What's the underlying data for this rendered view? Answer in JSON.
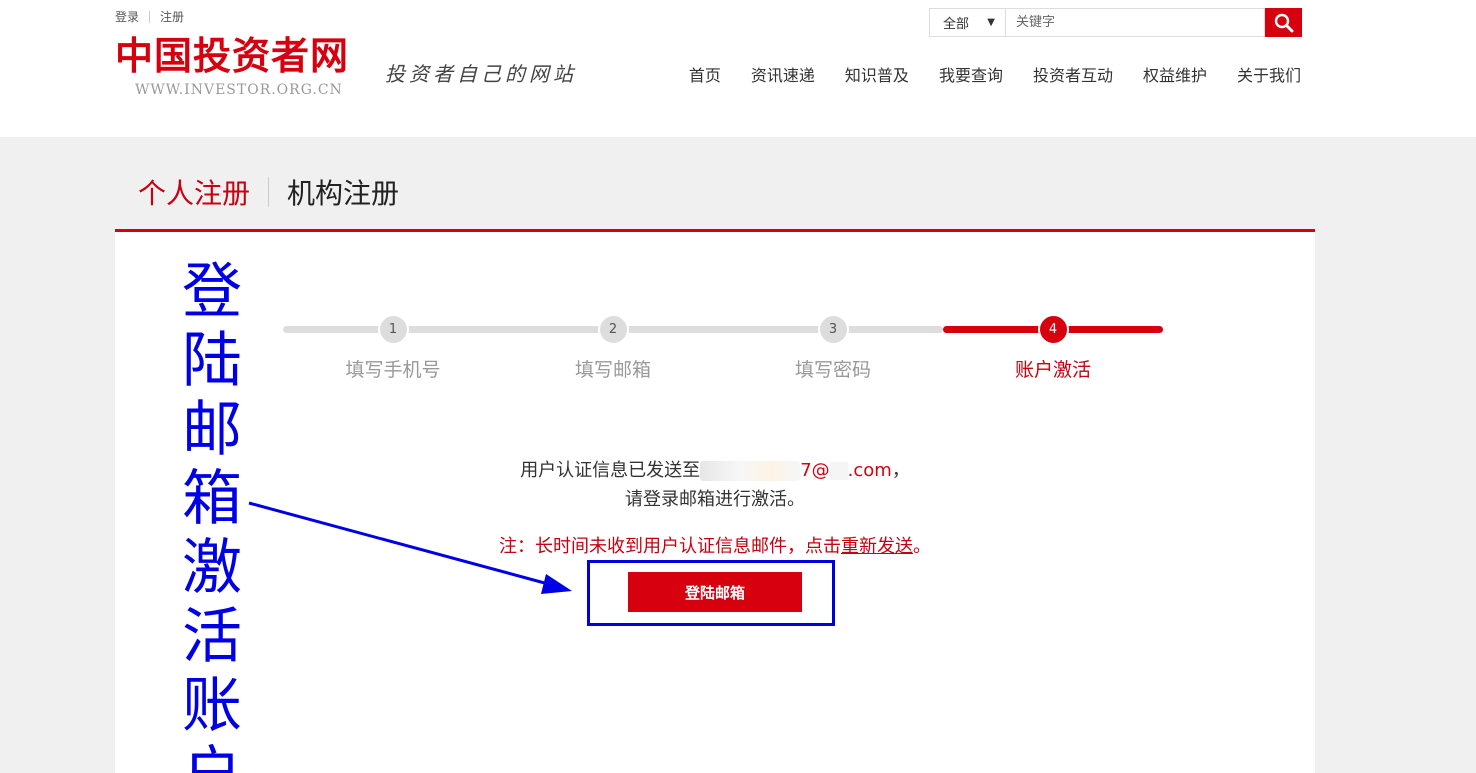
{
  "header": {
    "top_links": {
      "login": "登录",
      "register": "注册"
    },
    "logo_cn": "中国投资者网",
    "logo_en": "WWW.INVESTOR.ORG.CN",
    "slogan": "投资者自己的网站",
    "search": {
      "scope": "全部",
      "placeholder": "关键字",
      "icon": "search-icon"
    },
    "nav": [
      "首页",
      "资讯速递",
      "知识普及",
      "我要查询",
      "投资者互动",
      "权益维护",
      "关于我们"
    ]
  },
  "tabs": {
    "active": "个人注册",
    "inactive": "机构注册"
  },
  "steps": [
    {
      "num": "1",
      "label": "填写手机号"
    },
    {
      "num": "2",
      "label": "填写邮箱"
    },
    {
      "num": "3",
      "label": "填写密码"
    },
    {
      "num": "4",
      "label": "账户激活"
    }
  ],
  "active_step": 4,
  "info": {
    "line1_prefix": "用户认证信息已发送至",
    "email_visible_a": "7@",
    "email_visible_b": ".com",
    "line1_suffix": "，",
    "line2": "请登录邮箱进行激活。"
  },
  "note": {
    "prefix": "注：长时间未收到用户认证信息邮件，点击",
    "link": "重新发送",
    "suffix": "。"
  },
  "login_button": "登陆邮箱",
  "annotation": {
    "text": [
      "登",
      "陆",
      "邮",
      "箱",
      "激",
      "活",
      "账",
      "户"
    ],
    "color": "#0000e6"
  },
  "colors": {
    "brand_red": "#d7000f",
    "annotation_blue": "#0000e6"
  }
}
